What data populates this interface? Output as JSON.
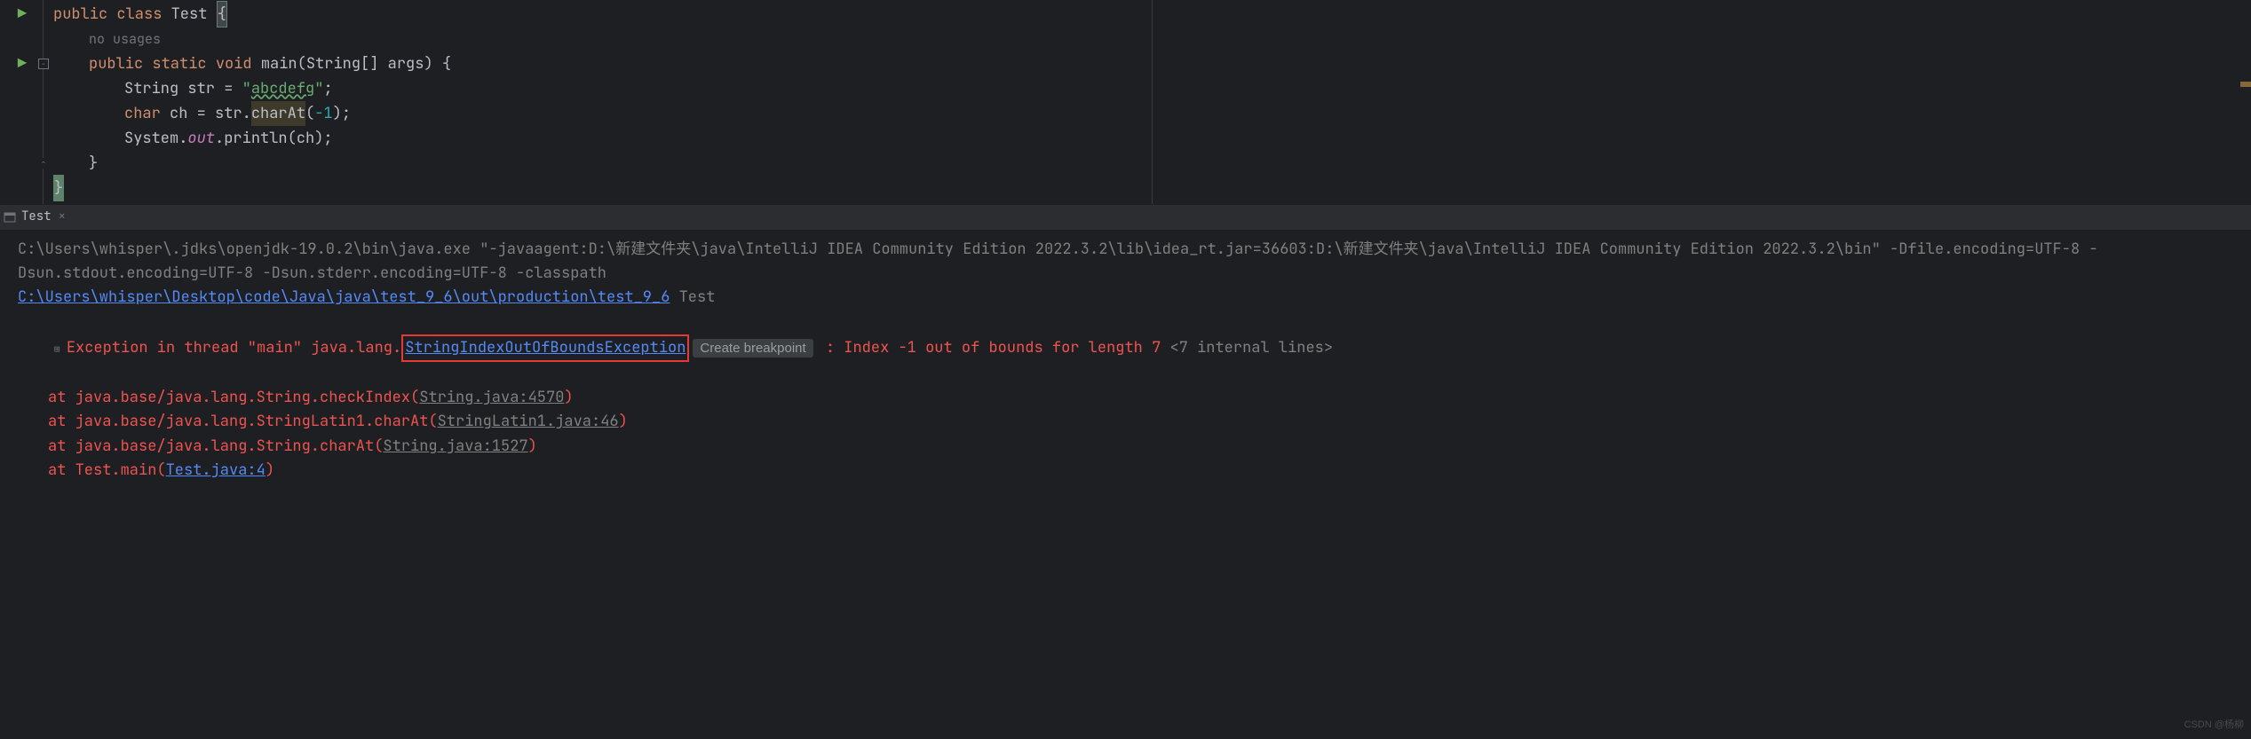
{
  "editor": {
    "hint_no_usages": "no usages",
    "lines": {
      "l1": {
        "public": "public",
        "class": "class",
        "name": "Test",
        "brace": "{"
      },
      "l3": {
        "public": "public",
        "static": "static",
        "void": "void",
        "main": "main",
        "params": "(String[] args) {"
      },
      "l4": {
        "type": "String",
        "var": "str",
        "eq": " = ",
        "q1": "\"",
        "val": "abcdefg",
        "q2": "\"",
        "semi": ";"
      },
      "l5": {
        "type": "char",
        "var": "ch",
        "eq": " = str.",
        "method": "charAt",
        "open": "(",
        "num": "-1",
        "close": ");"
      },
      "l6": {
        "sys": "System.",
        "out": "out",
        "dot": ".println(ch);"
      },
      "l7": {
        "brace": "}"
      },
      "l8": {
        "brace": "}"
      }
    }
  },
  "tab": {
    "label": "Test",
    "close": "×"
  },
  "console": {
    "cmd_prefix": "C:\\Users\\whisper\\.jdks\\openjdk-19.0.2\\bin\\java.exe \"-javaagent:D:\\新建文件夹\\java\\IntelliJ IDEA Community Edition 2022.3.2\\lib\\idea_rt.jar=36603:D:\\新建文件夹\\java\\IntelliJ IDEA Community Edition 2022.3.2\\bin\" -Dfile.encoding=UTF-8 -Dsun.stdout.encoding=UTF-8 -Dsun.stderr.encoding=UTF-8 -classpath ",
    "classpath_link": "C:\\Users\\whisper\\Desktop\\code\\Java\\java\\test_9_6\\out\\production\\test_9_6",
    "main_class": " Test",
    "exception_prefix": "Exception in thread \"main\" java.lang.",
    "exception_class": "StringIndexOutOfBoundsException",
    "breakpoint_label": "Create breakpoint",
    "exception_msg": " : Index -1 out of bounds for length 7 ",
    "internal_lines": "<7 internal lines>",
    "stack": [
      {
        "prefix": "at java.base/java.lang.String.checkIndex(",
        "link": "String.java:4570",
        "suffix": ")"
      },
      {
        "prefix": "at java.base/java.lang.StringLatin1.charAt(",
        "link": "StringLatin1.java:46",
        "suffix": ")"
      },
      {
        "prefix": "at java.base/java.lang.String.charAt(",
        "link": "String.java:1527",
        "suffix": ")"
      },
      {
        "prefix": "at Test.main(",
        "link": "Test.java:4",
        "suffix": ")"
      }
    ]
  },
  "watermark": "CSDN @杨柳"
}
